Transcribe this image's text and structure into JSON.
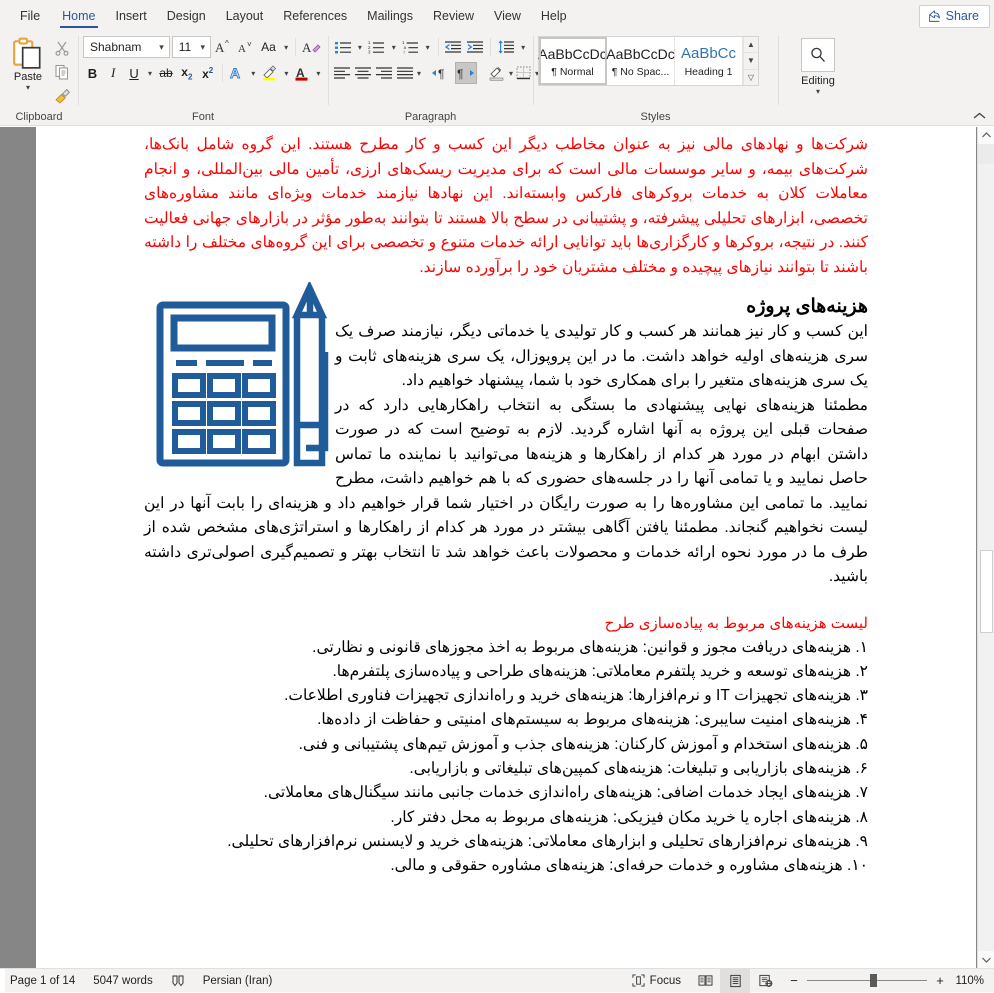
{
  "tabs": [
    {
      "label": "File",
      "active": false
    },
    {
      "label": "Home",
      "active": true
    },
    {
      "label": "Insert",
      "active": false
    },
    {
      "label": "Design",
      "active": false
    },
    {
      "label": "Layout",
      "active": false
    },
    {
      "label": "References",
      "active": false
    },
    {
      "label": "Mailings",
      "active": false
    },
    {
      "label": "Review",
      "active": false
    },
    {
      "label": "View",
      "active": false
    },
    {
      "label": "Help",
      "active": false
    }
  ],
  "share": {
    "label": "Share",
    "icon": "share-icon"
  },
  "ribbon": {
    "clipboard": {
      "label": "Clipboard",
      "paste_label": "Paste",
      "paste_icon": "paste-icon",
      "cut_icon": "scissors-icon",
      "copy_icon": "copy-icon",
      "format_painter_icon": "format-painter-icon",
      "dialog_launcher": "dialog-launcher-icon"
    },
    "font": {
      "label": "Font",
      "font_name": "Shabnam",
      "font_size": "11",
      "grow_font_icon": "grow-font-icon",
      "shrink_font_icon": "shrink-font-icon",
      "change_case_label": "Aa",
      "clear_formatting_icon": "clear-formatting-icon",
      "bold_label": "B",
      "italic_label": "I",
      "underline_label": "U",
      "strikethrough_label": "ab",
      "subscript_label": "x",
      "superscript_label": "x",
      "text_effects_label": "A",
      "highlight_label": "A",
      "font_color_label": "A",
      "highlight_color": "#ffff00",
      "font_color": "#c00000",
      "dialog_launcher": "dialog-launcher-icon"
    },
    "paragraph": {
      "label": "Paragraph",
      "bullets_icon": "bullets-icon",
      "numbering_icon": "numbering-icon",
      "multilevel_icon": "multilevel-list-icon",
      "decrease_indent_icon": "decrease-indent-icon",
      "increase_indent_icon": "increase-indent-icon",
      "line_spacing_icon": "line-spacing-icon",
      "align_left_icon": "align-left-icon",
      "align_center_icon": "align-center-icon",
      "align_right_icon": "align-right-icon",
      "justify_icon": "justify-icon",
      "ltr_icon": "left-to-right-icon",
      "rtl_icon": "right-to-left-icon",
      "shading_icon": "shading-icon",
      "borders_icon": "borders-icon",
      "sort_icon": "sort-icon",
      "show_marks_icon": "show-formatting-marks-icon",
      "dialog_launcher": "dialog-launcher-icon"
    },
    "styles": {
      "label": "Styles",
      "items": [
        {
          "preview": "AaBbCcDc",
          "name": "¶ Normal",
          "selected": true
        },
        {
          "preview": "AaBbCcDc",
          "name": "¶ No Spac...",
          "selected": false
        },
        {
          "preview": "AaBbCс",
          "name": "Heading 1",
          "selected": false
        }
      ],
      "dialog_launcher": "dialog-launcher-icon"
    },
    "editing": {
      "label": "Editing",
      "find_icon": "search-icon"
    },
    "collapse_icon": "collapse-ribbon-icon"
  },
  "document": {
    "intro_paragraph": "شرکت‌ها و نهادهای مالی نیز به عنوان مخاطب دیگر این کسب و کار مطرح هستند. این گروه شامل بانک‌ها، شرکت‌های بیمه، و سایر موسسات مالی است که برای مدیریت ریسک‌های ارزی، تأمین مالی بین‌المللی، و انجام معاملات کلان به خدمات بروکرهای فارکس وابسته‌اند. این نهادها نیازمند خدمات ویژه‌ای مانند مشاوره‌های تخصصی، ابزارهای تحلیلی پیشرفته، و پشتیبانی در سطح بالا هستند تا بتوانند به‌طور مؤثر در بازارهای جهانی فعالیت کنند. در نتیجه، بروکرها و کارگزاری‌ها باید توانایی ارائه خدمات متنوع و تخصصی برای این گروه‌های مختلف را داشته باشند تا بتوانند نیازهای پیچیده و مختلف مشتریان خود را برآورده سازند.",
    "heading": "هزینه‌های پروژه",
    "body_paragraph_1": "این کسب و کار نیز همانند هر کسب و کار تولیدی یا خدماتی دیگر، نیازمند صرف یک سری هزینه‌های اولیه خواهد داشت. ما در این پروپوزال، یک سری هزینه‌های ثابت و یک سری هزینه‌های متغیر را برای همکاری خود با شما، پیشنهاد خواهیم داد.",
    "body_paragraph_2": "مطمئنا هزینه‌های نهایی پیشنهادی ما بستگی به انتخاب راهکارهایی دارد که در صفحات قبلی این پروژه به آنها اشاره گردید. لازم به توضیح است که در صورت داشتن ابهام در مورد هر کدام از راهکارها و هزینه‌ها می‌توانید با نماینده ما تماس حاصل نمایید و یا تمامی آنها را در جلسه‌های حضوری که با هم خواهیم داشت، مطرح نمایید. ما تمامی این مشاوره‌ها را به صورت رایگان در اختیار شما قرار خواهیم داد و هزینه‌ای را بابت آنها در این لیست نخواهیم گنجاند. مطمئنا یافتن آگاهی بیشتر در مورد هر کدام از راهکارها و استراتژی‌های مشخص شده از طرف ما در مورد نحوه ارائه خدمات و محصولات باعث خواهد شد تا انتخاب بهتر و تصمیم‌گیری اصولی‌تری داشته باشید.",
    "list_heading": "لیست هزینه‌های مربوط به پیاده‌سازی طرح",
    "list_items": [
      "۱. هزینه‌های دریافت مجوز و قوانین: هزینه‌های مربوط به اخذ مجوزهای قانونی و نظارتی.",
      "۲. هزینه‌های توسعه و خرید پلتفرم معاملاتی: هزینه‌های طراحی و پیاده‌سازی پلتفرم‌ها.",
      "۳. هزینه‌های تجهیزات IT و نرم‌افزارها: هزینه‌های خرید و راه‌اندازی تجهیزات فناوری اطلاعات.",
      "۴. هزینه‌های امنیت سایبری: هزینه‌های مربوط به سیستم‌های امنیتی و حفاظت از داده‌ها.",
      "۵. هزینه‌های استخدام و آموزش کارکنان: هزینه‌های جذب و آموزش تیم‌های پشتیبانی و فنی.",
      "۶. هزینه‌های بازاریابی و تبلیغات: هزینه‌های کمپین‌های تبلیغاتی و بازاریابی.",
      "۷. هزینه‌های ایجاد خدمات اضافی: هزینه‌های راه‌اندازی خدمات جانبی مانند سیگنال‌های معاملاتی.",
      "۸. هزینه‌های اجاره یا خرید مکان فیزیکی: هزینه‌های مربوط به محل دفتر کار.",
      "۹. هزینه‌های نرم‌افزارهای تحلیلی و ابزارهای معاملاتی: هزینه‌های خرید و لایسنس نرم‌افزارهای تحلیلی.",
      "۱۰. هزینه‌های مشاوره و خدمات حرفه‌ای: هزینه‌های مشاوره حقوقی و مالی."
    ],
    "illustration": "calculator-and-pen-icon",
    "illustration_color": "#1F5C99",
    "red_color": "#FF0000"
  },
  "status_bar": {
    "page": "Page 1 of 14",
    "words": "5047 words",
    "proofing_icon": "proofing-errors-icon",
    "language": "Persian (Iran)",
    "focus_label": "Focus",
    "focus_icon": "focus-mode-icon",
    "read_mode_icon": "read-mode-icon",
    "print_layout_icon": "print-layout-icon",
    "web_layout_icon": "web-layout-icon",
    "zoom_out": "−",
    "zoom_in": "+",
    "zoom_level": "110%"
  }
}
